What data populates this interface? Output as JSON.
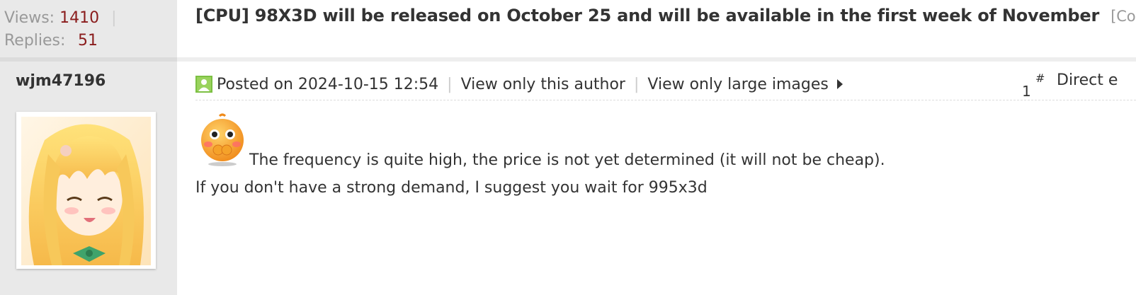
{
  "thread": {
    "views_label": "Views:",
    "views_count": "1410",
    "stat_separator": "|",
    "replies_label": "Replies:",
    "replies_count": "51",
    "title": "[CPU] 98X3D will be released on October 25 and will be available in the first week of November",
    "copy_link": "[Copy link]"
  },
  "post": {
    "author": "wjm47196",
    "posted_on": "Posted on 2024-10-15 12:54",
    "meta_separator": "|",
    "view_only_author": "View only this author",
    "view_only_large_images": "View only large images",
    "floor_number": "1",
    "floor_hash": "#",
    "direct_jump": "Direct e",
    "body_line1": "The frequency is quite high, the price is not yet determined (it will not be cheap).",
    "body_line2": "If you don't have a strong demand, I suggest you wait for 995x3d"
  },
  "icons": {
    "online_status": "online-user-icon",
    "caret": "caret-right-icon",
    "emoji": "shy-face-emoji-icon",
    "avatar": "anime-girl-avatar"
  },
  "colors": {
    "accent_red": "#8a1c1c",
    "muted": "#999999",
    "text": "#333333",
    "sidebar_bg": "#e9e9e9",
    "online_green": "#7cc043"
  }
}
